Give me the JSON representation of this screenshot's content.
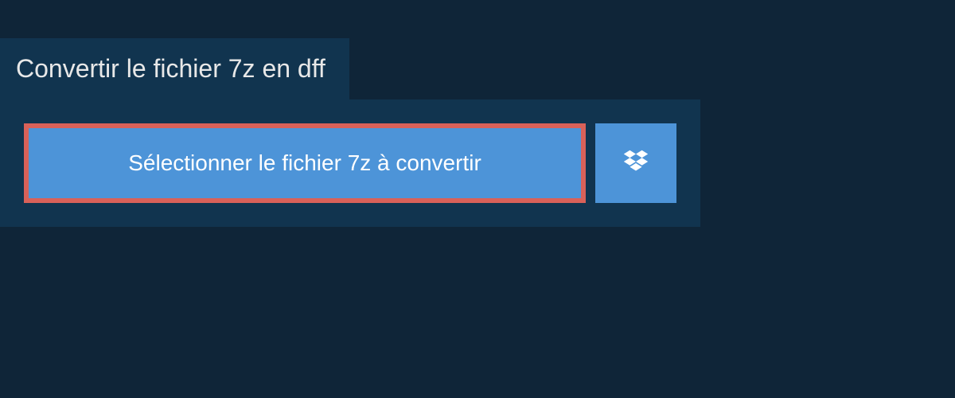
{
  "header": {
    "title": "Convertir le fichier 7z en dff"
  },
  "upload": {
    "select_button_label": "Sélectionner le fichier 7z à convertir",
    "dropbox_icon_name": "dropbox-icon"
  },
  "colors": {
    "page_bg": "#0f2538",
    "panel_bg": "#11344f",
    "button_bg": "#4d94d8",
    "highlight_border": "#d96159",
    "text_light": "#e8e8e8"
  }
}
